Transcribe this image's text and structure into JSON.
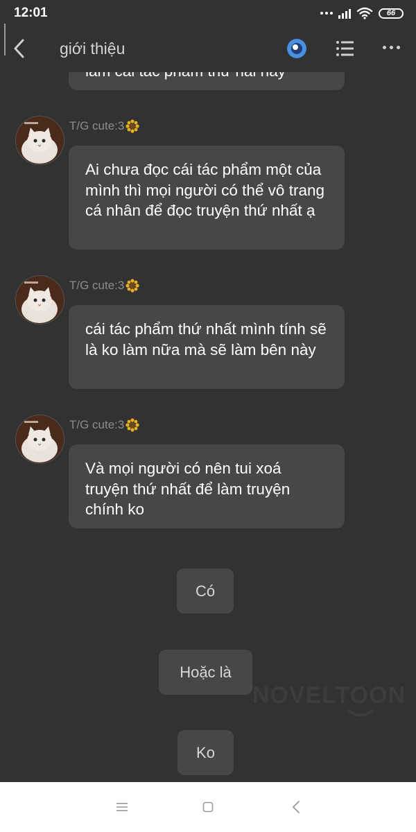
{
  "status_bar": {
    "time": "12:01",
    "battery": "66"
  },
  "header": {
    "title": "giới thiệu"
  },
  "messages": [
    {
      "text": "làm cái tác phẩm thứ hai này"
    },
    {
      "sender": "T/G cute:3",
      "text": "Ai chưa đọc cái tác phẩm một của mình thì mọi người có thể vô trang cá nhân để đọc truyện thứ nhất ạ"
    },
    {
      "sender": "T/G cute:3",
      "text": "cái tác phẩm thứ nhất mình tính sẽ là ko làm nữa mà sẽ làm bên này"
    },
    {
      "sender": "T/G cute:3",
      "text": "Và mọi người có nên tui xoá truyện thứ nhất để làm truyện chính  ko"
    }
  ],
  "choices": [
    {
      "label": "Có"
    },
    {
      "label": "Hoặc là"
    },
    {
      "label": "Ko"
    }
  ],
  "watermark": "NOVELTOON",
  "icons": {
    "back": "chevron-left-icon",
    "eye": "eye-icon",
    "list": "list-icon",
    "more": "more-icon",
    "sender_badge": "sunflower-icon",
    "avatar": "cat-avatar",
    "nav_menu": "menu-icon",
    "nav_home": "home-icon",
    "nav_back": "back-triangle-icon"
  },
  "colors": {
    "background": "#323232",
    "bubble": "#474747",
    "accent": "#4a90e2"
  }
}
